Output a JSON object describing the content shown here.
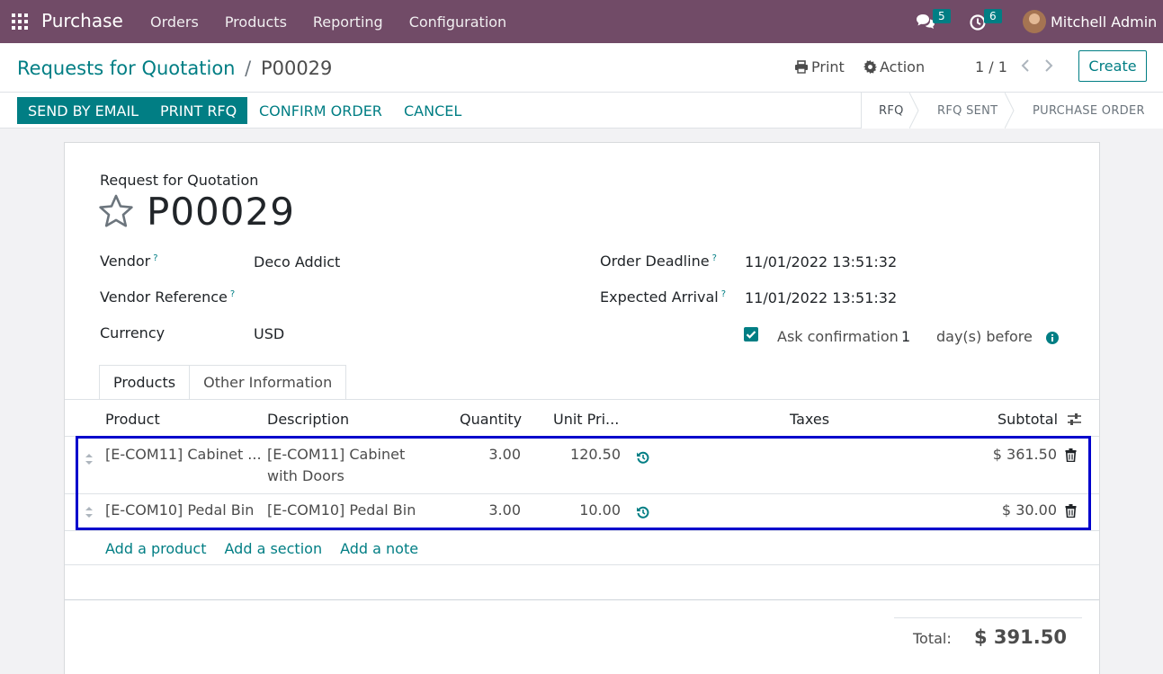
{
  "navbar": {
    "app_name": "Purchase",
    "menu": [
      "Orders",
      "Products",
      "Reporting",
      "Configuration"
    ],
    "messages_count": "5",
    "activities_count": "6",
    "user_name": "Mitchell Admin"
  },
  "control": {
    "breadcrumb_parent": "Requests for Quotation",
    "breadcrumb_sep": "/",
    "breadcrumb_current": "P00029",
    "print_label": "Print",
    "action_label": "Action",
    "pager": "1 / 1",
    "create_label": "Create"
  },
  "statusbar": {
    "send_email": "SEND BY EMAIL",
    "print_rfq": "PRINT RFQ",
    "confirm_order": "CONFIRM ORDER",
    "cancel": "CANCEL",
    "stages": [
      "RFQ",
      "RFQ SENT",
      "PURCHASE ORDER"
    ],
    "active_stage": "RFQ"
  },
  "form": {
    "doc_type": "Request for Quotation",
    "name": "P00029",
    "vendor_label": "Vendor",
    "vendor_value": "Deco Addict",
    "vendor_ref_label": "Vendor Reference",
    "vendor_ref_value": "",
    "currency_label": "Currency",
    "currency_value": "USD",
    "deadline_label": "Order Deadline",
    "deadline_value": "11/01/2022 13:51:32",
    "arrival_label": "Expected Arrival",
    "arrival_value": "11/01/2022 13:51:32",
    "ask_confirmation_label": "Ask confirmation",
    "ask_confirmation_days": "1",
    "days_before_label": "day(s) before",
    "help_mark": "?"
  },
  "tabs": [
    "Products",
    "Other Information"
  ],
  "table": {
    "headers": {
      "product": "Product",
      "description": "Description",
      "quantity": "Quantity",
      "unit_price": "Unit Pri...",
      "taxes": "Taxes",
      "subtotal": "Subtotal"
    },
    "rows": [
      {
        "product": "[E-COM11] Cabinet ...",
        "description_1": "[E-COM11] Cabinet",
        "description_2": "with Doors",
        "quantity": "3.00",
        "unit_price": "120.50",
        "subtotal": "$ 361.50"
      },
      {
        "product": "[E-COM10] Pedal Bin",
        "description_1": "[E-COM10] Pedal Bin",
        "description_2": "",
        "quantity": "3.00",
        "unit_price": "10.00",
        "subtotal": "$ 30.00"
      }
    ],
    "add_product": "Add a product",
    "add_section": "Add a section",
    "add_note": "Add a note"
  },
  "totals": {
    "label": "Total:",
    "value": "$ 391.50"
  },
  "colors": {
    "navbar": "#714b67",
    "accent": "#017e84",
    "highlight": "#0000cc"
  }
}
